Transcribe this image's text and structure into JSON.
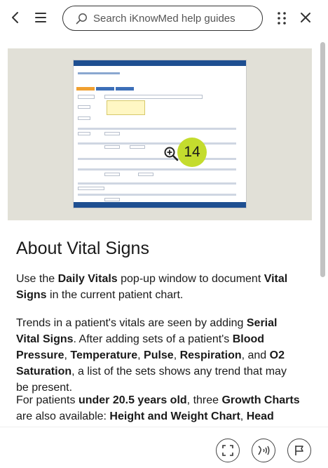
{
  "topbar": {
    "back_icon": "chevron-left-icon",
    "menu_icon": "hamburger-menu-icon",
    "search": {
      "placeholder": "Search iKnowMed help guides",
      "value": "",
      "icon": "search-icon"
    },
    "more_icon": "grid-dots-icon",
    "close_icon": "close-icon"
  },
  "hero": {
    "step_number": "14",
    "zoom_icon": "zoom-in-icon",
    "badge_color": "#c4dc2e",
    "background_color": "#e1e0d7"
  },
  "article": {
    "heading": "About Vital Signs",
    "paragraphs": [
      [
        {
          "text": "Use the ",
          "bold": false
        },
        {
          "text": "Daily Vitals",
          "bold": true
        },
        {
          "text": " pop-up window to document ",
          "bold": false
        },
        {
          "text": "Vital Signs",
          "bold": true
        },
        {
          "text": " in the current patient chart.",
          "bold": false
        }
      ],
      [
        {
          "text": "Trends in a patient's vitals are seen by adding ",
          "bold": false
        },
        {
          "text": "Serial Vital Signs",
          "bold": true
        },
        {
          "text": ". After adding sets of a patient's ",
          "bold": false
        },
        {
          "text": "Blood Pressure",
          "bold": true
        },
        {
          "text": ", ",
          "bold": false
        },
        {
          "text": "Temperature",
          "bold": true
        },
        {
          "text": ", ",
          "bold": false
        },
        {
          "text": "Pulse",
          "bold": true
        },
        {
          "text": ", ",
          "bold": false
        },
        {
          "text": "Respiration",
          "bold": true
        },
        {
          "text": ", and ",
          "bold": false
        },
        {
          "text": "O2 Saturation",
          "bold": true
        },
        {
          "text": ", a list of the sets shows any trend that may be present.",
          "bold": false
        }
      ],
      [
        {
          "text": "For patients ",
          "bold": false
        },
        {
          "text": "under 20.5 years old",
          "bold": true
        },
        {
          "text": ", three ",
          "bold": false
        },
        {
          "text": "Growth Charts",
          "bold": true
        },
        {
          "text": " are also available: ",
          "bold": false
        },
        {
          "text": "Height and Weight Chart",
          "bold": true
        },
        {
          "text": ", ",
          "bold": false
        },
        {
          "text": "Head",
          "bold": true
        }
      ]
    ]
  },
  "bottombar": {
    "fullscreen_icon": "fullscreen-icon",
    "audio_icon": "text-to-speech-icon",
    "flag_icon": "flag-icon"
  }
}
